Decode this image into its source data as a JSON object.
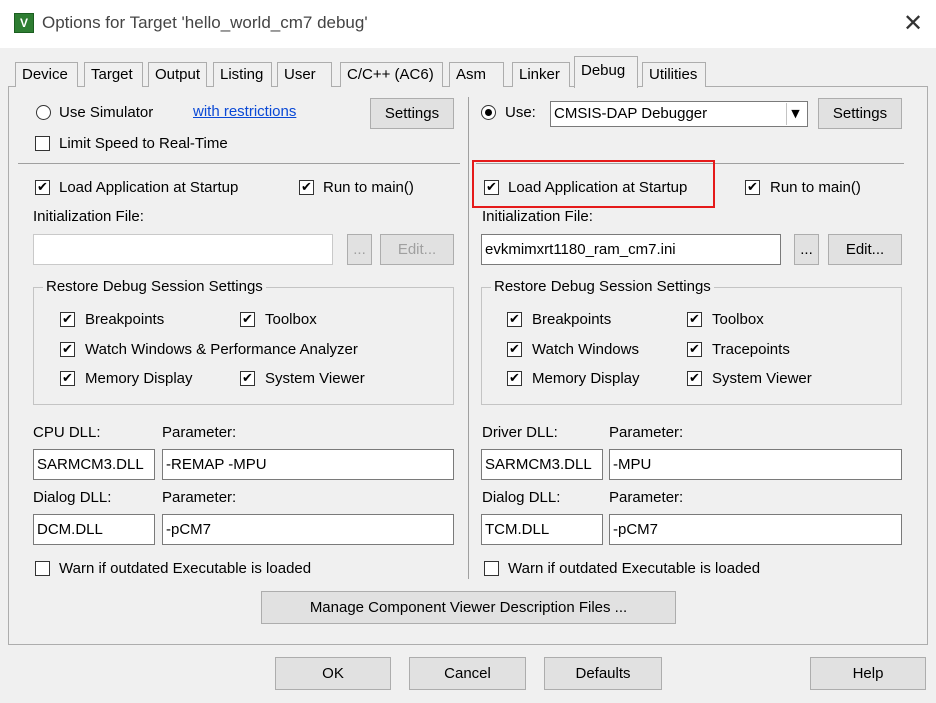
{
  "window": {
    "title": "Options for Target 'hello_world_cm7 debug'"
  },
  "tabs": [
    "Device",
    "Target",
    "Output",
    "Listing",
    "User",
    "C/C++ (AC6)",
    "Asm",
    "Linker",
    "Debug",
    "Utilities"
  ],
  "active_tab": "Debug",
  "left": {
    "use_simulator": "Use Simulator",
    "restrictions_link": "with restrictions",
    "settings_label": "Settings",
    "limit_speed": "Limit Speed to Real-Time",
    "load_app": "Load Application at Startup",
    "run_to_main": "Run to main()",
    "init_file_label": "Initialization File:",
    "init_file_value": "",
    "browse_label": "...",
    "edit_label": "Edit...",
    "restore_title": "Restore Debug Session Settings",
    "breakpoints": "Breakpoints",
    "toolbox": "Toolbox",
    "watch": "Watch Windows & Performance Analyzer",
    "memory": "Memory Display",
    "system_viewer": "System Viewer",
    "cpu_dll_label": "CPU DLL:",
    "cpu_param_label": "Parameter:",
    "cpu_dll_value": "SARMCM3.DLL",
    "cpu_param_value": "-REMAP -MPU",
    "dialog_dll_label": "Dialog DLL:",
    "dialog_param_label": "Parameter:",
    "dialog_dll_value": "DCM.DLL",
    "dialog_param_value": "-pCM7",
    "warn": "Warn if outdated Executable is loaded"
  },
  "right": {
    "use_label": "Use:",
    "debugger_value": "CMSIS-DAP Debugger",
    "settings_label": "Settings",
    "load_app": "Load Application at Startup",
    "run_to_main": "Run to main()",
    "init_file_label": "Initialization File:",
    "init_file_value": "evkmimxrt1180_ram_cm7.ini",
    "browse_label": "...",
    "edit_label": "Edit...",
    "restore_title": "Restore Debug Session Settings",
    "breakpoints": "Breakpoints",
    "toolbox": "Toolbox",
    "watch": "Watch Windows",
    "tracepoints": "Tracepoints",
    "memory": "Memory Display",
    "system_viewer": "System Viewer",
    "driver_dll_label": "Driver DLL:",
    "driver_param_label": "Parameter:",
    "driver_dll_value": "SARMCM3.DLL",
    "driver_param_value": "-MPU",
    "dialog_dll_label": "Dialog DLL:",
    "dialog_param_label": "Parameter:",
    "dialog_dll_value": "TCM.DLL",
    "dialog_param_value": "-pCM7",
    "warn": "Warn if outdated Executable is loaded"
  },
  "manage_button": "Manage Component Viewer Description Files ...",
  "footer": {
    "ok": "OK",
    "cancel": "Cancel",
    "defaults": "Defaults",
    "help": "Help"
  },
  "check_glyph": "✔"
}
